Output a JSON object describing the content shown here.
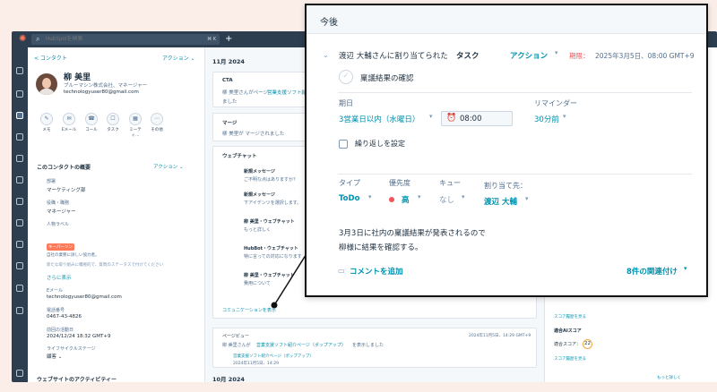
{
  "search": {
    "placeholder": "HubSpotを検索",
    "shortcut": "⌘ K"
  },
  "contact": {
    "back": "< コンタクト",
    "actions": "アクション ⌄",
    "name": "柳 美里",
    "subtitle": "ブルーマシン株式会社、マネージャー",
    "email": "technologyuser80@gmail.com",
    "quick_actions": [
      "メモ",
      "Eメール",
      "コール",
      "タスク",
      "ミーティ...",
      "その他"
    ],
    "about_title": "このコンタクトの概要",
    "about_actions": "アクション ⌄",
    "fields": [
      {
        "label": "部署",
        "value": "マーケティング部"
      },
      {
        "label": "役職・職務",
        "value": "マネージャー"
      },
      {
        "label": "人物ラベル",
        "value": "自社の業務に詳しい協力者。"
      },
      {
        "label": "",
        "value": "新たな取り組みに積極的で、質問のステータスで付けてください"
      }
    ],
    "badge": "キーパーソン",
    "more_link": "さらに表示",
    "email_label": "Eメール",
    "email_value": "technologyuser80@gmail.com",
    "phone_label": "電話番号",
    "phone_value": "0467-43-4826",
    "last_activity_label": "前回の活動日",
    "last_activity_value": "2024/12/24 18:32 GMT+9",
    "lifecycle_label": "ライフサイクルステージ",
    "lifecycle_value": "顧客 ⌄",
    "website_title": "ウェブサイトのアクティビティー"
  },
  "timeline": {
    "month1": "11月 2024",
    "cta_title": "CTA",
    "cta_text": "柳 美里さんがページ",
    "cta_link": "営業支援ソフト紹介",
    "cta_text2": "ました",
    "merge_title": "マージ",
    "merge_text": "柳 美里が マージされました",
    "webchat_title": "ウェブチャット",
    "chat_items": [
      {
        "title": "新規メッセージ",
        "text": "ご不明な点はありますか？"
      },
      {
        "title": "新規メッセージ",
        "text": "下アイデンツを選択します。"
      },
      {
        "title": "柳 美里・ウェブチャット",
        "text": "もっと詳しく"
      },
      {
        "title": "HubBot・ウェブチャット",
        "text": "特に言っての対応になります"
      },
      {
        "title": "柳 美里・ウェブチャット",
        "text": "費用について"
      }
    ],
    "comm_link": "コミュニケーションを表示",
    "pageview_title": "ページビュー",
    "pageview_date": "2024年11月5日、14:29 GMT+9",
    "pageview_text": "柳 美里さんが",
    "pageview_link": "営業支援ソフト紹介ページ（ポップアップ）",
    "pageview_text2": "を表示しました",
    "pageview_sub_link": "営業支援ソフト紹介ページ（ポップアップ）",
    "pageview_sub_date": "2024年11月5日、14:29",
    "month2": "10月 2024"
  },
  "right": {
    "score_link1": "スコア履歴を見る",
    "fit_label": "適合AIスコア",
    "fit_title": "適合スコア：",
    "fit_value": "22",
    "score_link2": "スコア履歴を見る",
    "more": "もっと詳しく"
  },
  "popup": {
    "title": "今後",
    "task_prefix": "渡辺 大輔さんに割り当てられた",
    "task_word": "タスク",
    "action": "アクション",
    "due": "期限：",
    "due_value": "2025年3月5日、08:00 GMT+9",
    "task_name": "稟議結果の確認",
    "due_date_label": "期日",
    "due_date_value": "3営業日以内（水曜日）",
    "time_value": "08:00",
    "reminder_label": "リマインダー",
    "reminder_value": "30分前",
    "repeat_label": "繰り返しを設定",
    "type_label": "タイプ",
    "type_value": "ToDo",
    "priority_label": "優先度",
    "priority_value": "高",
    "queue_label": "キュー",
    "queue_value": "なし",
    "assignee_label": "割り当て先：",
    "assignee_value": "渡辺 大輔",
    "note_line1": "3月3日に社内の稟議結果が発表されるので",
    "note_line2": "柳様に結果を確認する。",
    "comment": "コメントを追加",
    "associations": "8件の関連付け"
  },
  "colors": {
    "accent": "#0091ae",
    "nav": "#2d3e50",
    "orange": "#ff7a59",
    "priority": "#f2545b"
  }
}
